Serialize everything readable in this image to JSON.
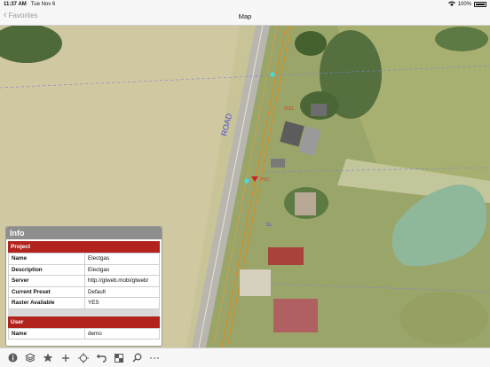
{
  "status_bar": {
    "time": "11:37 AM",
    "date": "Tue Nov 6",
    "battery": "100%"
  },
  "nav": {
    "back_label": "Favorites",
    "title": "Map"
  },
  "map": {
    "road_label": "ROAD",
    "annotations": [
      "5521",
      "PNC",
      "SL"
    ]
  },
  "info": {
    "title": "Info",
    "project_header": "Project",
    "project_rows": [
      {
        "key": "Name",
        "value": "Electgas"
      },
      {
        "key": "Description",
        "value": "Electgas"
      },
      {
        "key": "Server",
        "value": "http://gtweb.mobi/gtweb/"
      },
      {
        "key": "Current Preset",
        "value": "Default"
      },
      {
        "key": "Raster Available",
        "value": "YES"
      }
    ],
    "user_header": "User",
    "user_rows": [
      {
        "key": "Name",
        "value": "demo"
      }
    ]
  },
  "toolbar": {
    "icons": [
      "info-icon",
      "layers-icon",
      "star-icon",
      "plus-icon",
      "locate-icon",
      "undo-icon",
      "grid-icon",
      "search-icon",
      "more-icon"
    ]
  }
}
